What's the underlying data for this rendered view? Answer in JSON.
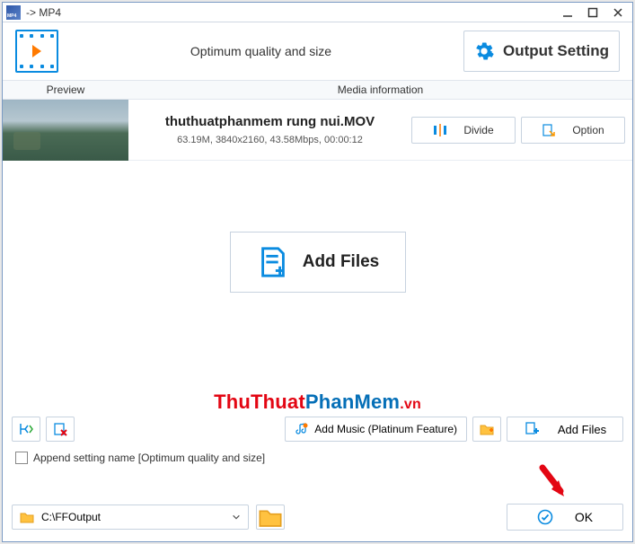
{
  "window": {
    "title": "-> MP4"
  },
  "header": {
    "subtitle": "Optimum quality and size",
    "output_setting_label": "Output Setting"
  },
  "columns": {
    "preview": "Preview",
    "media_info": "Media information"
  },
  "file": {
    "name": "thuthuatphanmem rung nui.MOV",
    "meta": "63.19M, 3840x2160, 43.58Mbps, 00:00:12",
    "divide_label": "Divide",
    "option_label": "Option"
  },
  "add_files_big": "Add Files",
  "watermark": {
    "part1": "ThuThuat",
    "part2": "PhanMem",
    "part3": ".vn"
  },
  "toolbar": {
    "add_music_label": "Add Music (Platinum Feature)",
    "add_files_label": "Add Files"
  },
  "append": {
    "label": "Append setting name [Optimum quality and size]",
    "checked": false
  },
  "output": {
    "path": "C:\\FFOutput",
    "ok_label": "OK"
  },
  "icons": {
    "gear": "gear-icon",
    "divide": "divide-icon",
    "option": "option-icon",
    "doc_add": "document-add-icon",
    "merge": "merge-icon",
    "remove": "remove-icon",
    "music": "music-icon",
    "folder_add": "folder-add-icon",
    "file_add": "file-add-icon",
    "folder": "folder-icon",
    "check": "check-circle-icon",
    "chevron": "chevron-down-icon"
  }
}
